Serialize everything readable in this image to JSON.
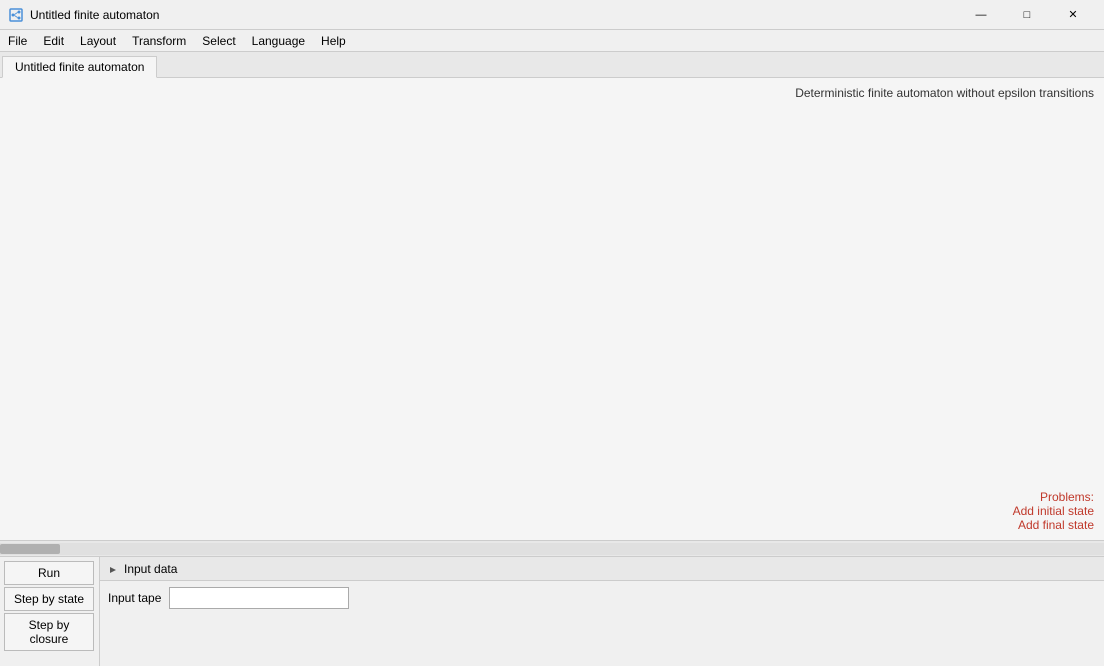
{
  "window": {
    "title": "Untitled finite automaton",
    "icon": "automaton-icon"
  },
  "menu": {
    "items": [
      {
        "label": "File",
        "id": "file"
      },
      {
        "label": "Edit",
        "id": "edit"
      },
      {
        "label": "Layout",
        "id": "layout"
      },
      {
        "label": "Transform",
        "id": "transform"
      },
      {
        "label": "Select",
        "id": "select"
      },
      {
        "label": "Language",
        "id": "language"
      },
      {
        "label": "Help",
        "id": "help"
      }
    ]
  },
  "tabs": [
    {
      "label": "Untitled finite automaton",
      "active": true
    }
  ],
  "canvas": {
    "automaton_type": "Deterministic finite automaton without epsilon transitions"
  },
  "problems": {
    "header": "Problems:",
    "items": [
      "Add initial state",
      "Add final state"
    ]
  },
  "bottom": {
    "buttons": [
      {
        "label": "Run",
        "id": "run"
      },
      {
        "label": "Step by state",
        "id": "step-by-state"
      },
      {
        "label": "Step by closure",
        "id": "step-by-closure"
      }
    ],
    "input_data": {
      "section_label": "Input data",
      "tape_label": "Input tape",
      "tape_value": "",
      "tape_placeholder": ""
    }
  },
  "controls": {
    "minimize": "—",
    "maximize": "□",
    "close": "✕"
  }
}
